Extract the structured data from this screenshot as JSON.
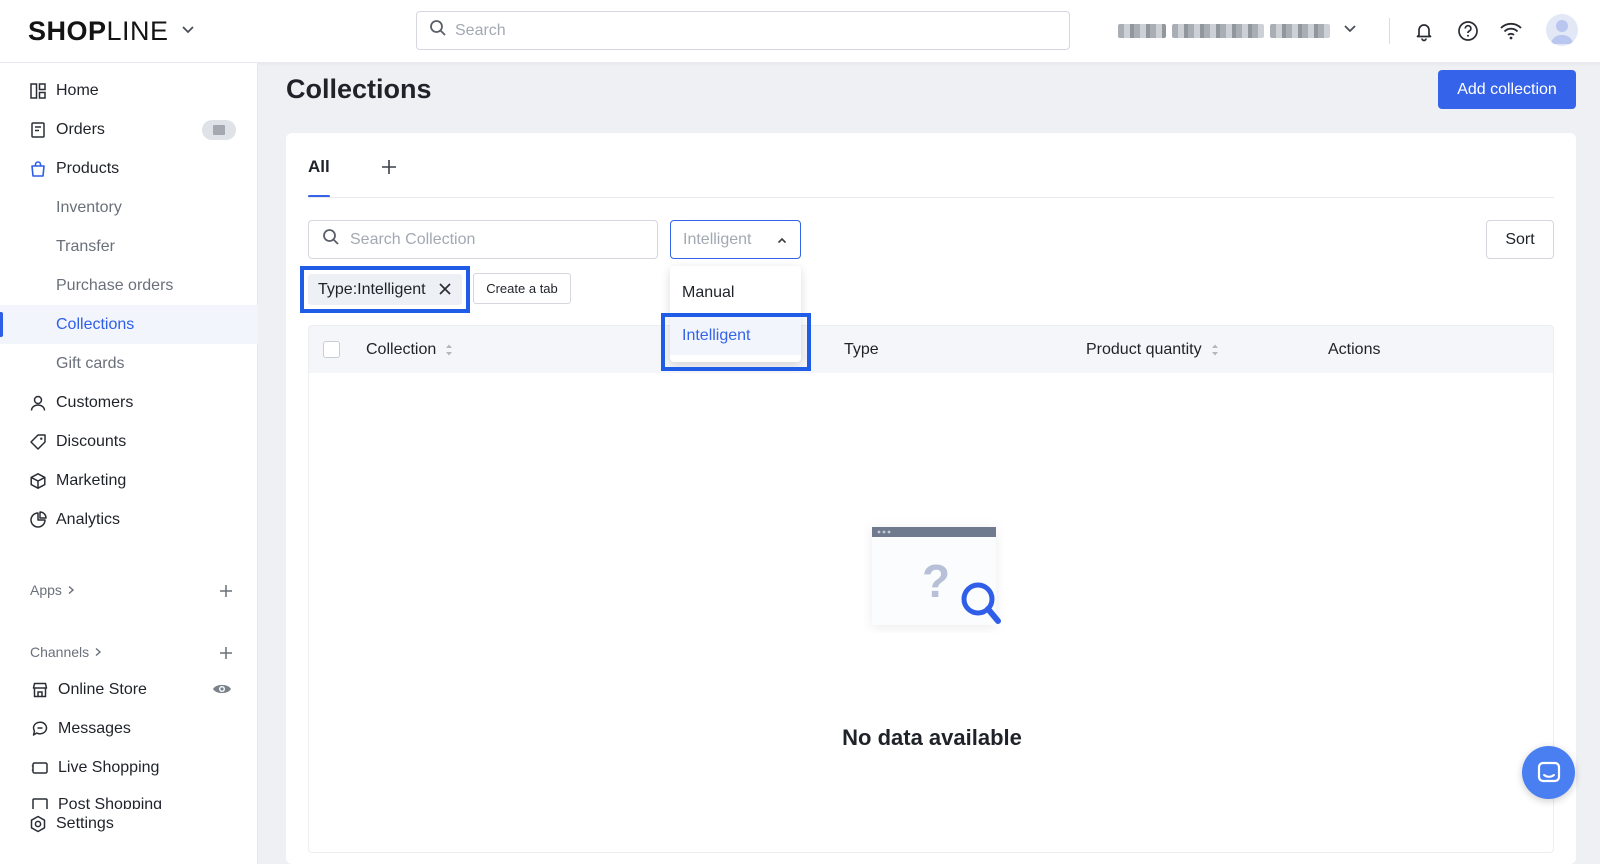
{
  "header": {
    "logo_bold": "SHOP",
    "logo_thin": "LINE",
    "search_placeholder": "Search",
    "icons": [
      "bell-icon",
      "help-icon",
      "wifi-icon",
      "avatar-icon"
    ]
  },
  "sidebar": {
    "items": [
      {
        "label": "Home",
        "icon": "home-icon"
      },
      {
        "label": "Orders",
        "icon": "orders-icon"
      },
      {
        "label": "Products",
        "icon": "bag-icon"
      },
      {
        "label": "Inventory"
      },
      {
        "label": "Transfer"
      },
      {
        "label": "Purchase orders"
      },
      {
        "label": "Collections"
      },
      {
        "label": "Gift cards"
      },
      {
        "label": "Customers",
        "icon": "user-icon"
      },
      {
        "label": "Discounts",
        "icon": "tag-icon"
      },
      {
        "label": "Marketing",
        "icon": "cube-icon"
      },
      {
        "label": "Analytics",
        "icon": "pie-icon"
      }
    ],
    "apps_label": "Apps",
    "channels_label": "Channels",
    "channels": [
      {
        "label": "Online Store",
        "icon": "store-icon"
      },
      {
        "label": "Messages",
        "icon": "chat-icon"
      },
      {
        "label": "Live Shopping",
        "icon": "video-icon"
      },
      {
        "label": "Post Shopping",
        "icon": "post-icon"
      }
    ],
    "settings_label": "Settings"
  },
  "main": {
    "title": "Collections",
    "add_button": "Add collection",
    "tab_all": "All",
    "search_placeholder": "Search Collection",
    "type_select_value": "Intelligent",
    "sort_label": "Sort",
    "filter_chip": "Type:Intelligent",
    "create_tab_label": "Create a tab",
    "columns": {
      "collection": "Collection",
      "type": "Type",
      "product_quantity": "Product quantity",
      "actions": "Actions"
    },
    "empty_text": "No data available"
  },
  "dropdown": {
    "options": [
      "Manual",
      "Intelligent"
    ],
    "selected": "Intelligent"
  },
  "colors": {
    "accent": "#3563e9",
    "highlight_border": "#1f5de6"
  }
}
